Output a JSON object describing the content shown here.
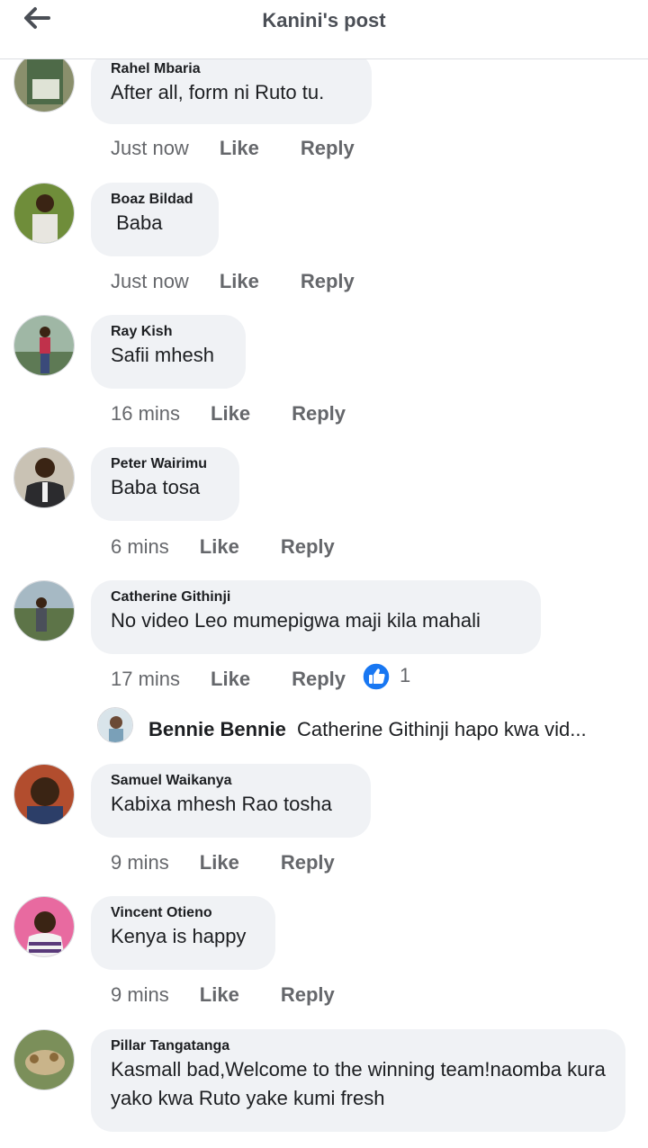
{
  "header": {
    "title": "Kanini's post"
  },
  "comments": [
    {
      "author": "Rahel Mbaria",
      "text": "After all, form ni Ruto tu.",
      "time": "Just now",
      "like": "Like",
      "reply": "Reply"
    },
    {
      "author": "Boaz Bildad",
      "text": " Baba",
      "time": "Just now",
      "like": "Like",
      "reply": "Reply"
    },
    {
      "author": "Ray Kish",
      "text": "Safii mhesh",
      "time": "16 mins",
      "like": "Like",
      "reply": "Reply"
    },
    {
      "author": "Peter Wairimu",
      "text": "Baba tosa",
      "time": "6 mins",
      "like": "Like",
      "reply": "Reply"
    },
    {
      "author": "Catherine Githinji",
      "text": "No video Leo mumepigwa maji kila mahali",
      "time": "17 mins",
      "like": "Like",
      "reply": "Reply",
      "reaction_count": "1"
    },
    {
      "author": "Samuel Waikanya",
      "text": "Kabixa mhesh Rao tosha",
      "time": "9 mins",
      "like": "Like",
      "reply": "Reply"
    },
    {
      "author": "Vincent Otieno",
      "text": "Kenya is happy",
      "time": "9 mins",
      "like": "Like",
      "reply": "Reply"
    },
    {
      "author": "Pillar Tangatanga",
      "text": "Kasmall bad,Welcome to the winning team!naomba kura yako kwa Ruto yake kumi fresh"
    }
  ],
  "reply_preview": {
    "author": "Bennie Bennie",
    "text": "Catherine Githinji hapo kwa vid..."
  },
  "icons": {
    "back": "back-arrow-icon",
    "reaction": "like-reaction-icon"
  },
  "colors": {
    "accent": "#1877f2",
    "bubble": "#f0f2f5",
    "meta": "#65676b"
  }
}
